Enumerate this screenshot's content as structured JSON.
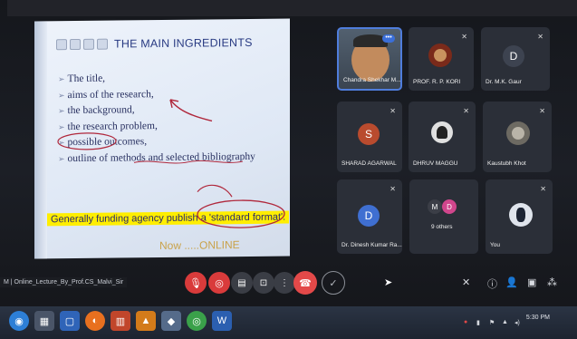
{
  "slide": {
    "title": "THE MAIN INGREDIENTS",
    "bullets": [
      "The title,",
      "aims of the research,",
      "the background,",
      "the research problem,",
      "possible outcomes,",
      "outline of methods and selected bibliography"
    ],
    "highlight_text": "Generally funding agency publish a 'standard format'.",
    "footer": "Now .....ONLINE"
  },
  "participants": [
    {
      "name": "Chandra Shekhar M...",
      "type": "video",
      "active": true
    },
    {
      "name": "PROF. R. P. KORI",
      "type": "photo"
    },
    {
      "name": "Dr. M.K. Gaur",
      "initial": "D"
    },
    {
      "name": "SHARAD AGARWAL",
      "initial": "S"
    },
    {
      "name": "DHRUV MAGGU",
      "type": "photo"
    },
    {
      "name": "Kaustubh Khot",
      "type": "photo"
    },
    {
      "name": "Dr. Dinesh Kumar Ra...",
      "initial": "D"
    },
    {
      "name": "9 others",
      "initials": [
        "M",
        "D"
      ]
    },
    {
      "name": "You",
      "type": "photo"
    }
  ],
  "callbar": {
    "meeting_label": "M | Online_Lecture_By_Prof.CS_Malvi_Sir"
  },
  "taskbar": {
    "time": "5:30 PM"
  },
  "colors": {
    "accent": "#4f7ddc",
    "end_call": "#e34949",
    "highlight": "#ffee00",
    "slide_title": "#283a82"
  },
  "icons": {
    "mic": "mic-off-icon",
    "camera": "camera-off-icon",
    "captions": "captions-icon",
    "present": "present-icon",
    "more": "more-options-icon",
    "end": "end-call-icon"
  }
}
